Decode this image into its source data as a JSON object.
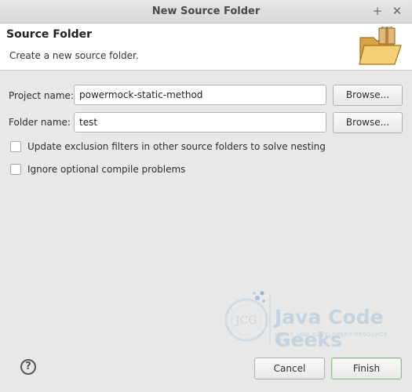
{
  "window": {
    "title": "New Source Folder",
    "icons": [
      "plus-icon",
      "close-icon"
    ]
  },
  "banner": {
    "heading": "Source Folder",
    "description": "Create a new source folder.",
    "icon": "folder-package-icon"
  },
  "form": {
    "project_label": "Project name:",
    "project_value": "powermock-static-method",
    "folder_label": "Folder name:",
    "folder_value": "test",
    "browse_label": "Browse...",
    "checkbox_exclusion_label": "Update exclusion filters in other source folders to solve nesting",
    "checkbox_exclusion_checked": false,
    "checkbox_ignore_label": "Ignore optional compile problems",
    "checkbox_ignore_checked": false
  },
  "watermark": {
    "brand": "Java Code Geeks",
    "tagline": "JAVA 2 JAVA DEVELOPERS RESOURCE CENTER",
    "logo_text": "JCG"
  },
  "footer": {
    "help_icon": "help-icon",
    "help_glyph": "?",
    "cancel_label": "Cancel",
    "finish_label": "Finish"
  },
  "colors": {
    "background": "#e8e8e7",
    "banner": "#ffffff",
    "default_button_border": "#8fb88f",
    "watermark": "#c5d3e0"
  }
}
